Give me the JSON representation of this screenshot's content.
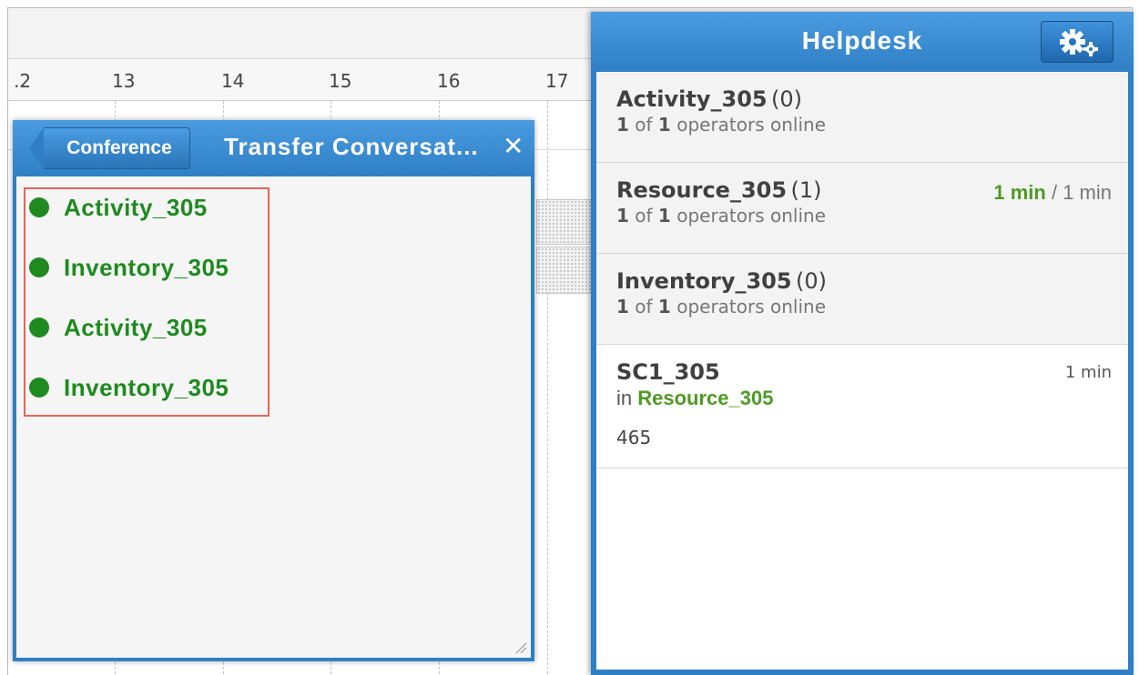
{
  "calendar": {
    "hours": [
      ".2",
      "13",
      "14",
      "15",
      "16",
      "17"
    ]
  },
  "transfer": {
    "conference_label": "Conference",
    "title": "Transfer Conversat...",
    "close_label": "✕",
    "queues": [
      {
        "label": "Activity_305"
      },
      {
        "label": "Inventory_305"
      },
      {
        "label": "Activity_305"
      },
      {
        "label": "Inventory_305"
      }
    ]
  },
  "helpdesk": {
    "title": "Helpdesk",
    "settings_icon": "gears-icon",
    "queues": [
      {
        "name": "Activity_305",
        "count": "(0)",
        "online": "1",
        "total": "1",
        "online_text": "operators online",
        "wait": "",
        "sep": "",
        "max": ""
      },
      {
        "name": "Resource_305",
        "count": "(1)",
        "online": "1",
        "total": "1",
        "online_text": "operators online",
        "wait": "1 min",
        "sep": "/",
        "max": "1 min"
      },
      {
        "name": "Inventory_305",
        "count": "(0)",
        "online": "1",
        "total": "1",
        "online_text": "operators online",
        "wait": "",
        "sep": "",
        "max": ""
      }
    ],
    "of_text": "of",
    "conversation": {
      "name": "SC1_305",
      "in_text": "in",
      "queue": "Resource_305",
      "message": "465",
      "time": "1 min"
    }
  },
  "colors": {
    "accent": "#2f7fc5",
    "online_green": "#1f8a1f",
    "wait_green": "#4e9a25",
    "highlight": "#e46558"
  }
}
